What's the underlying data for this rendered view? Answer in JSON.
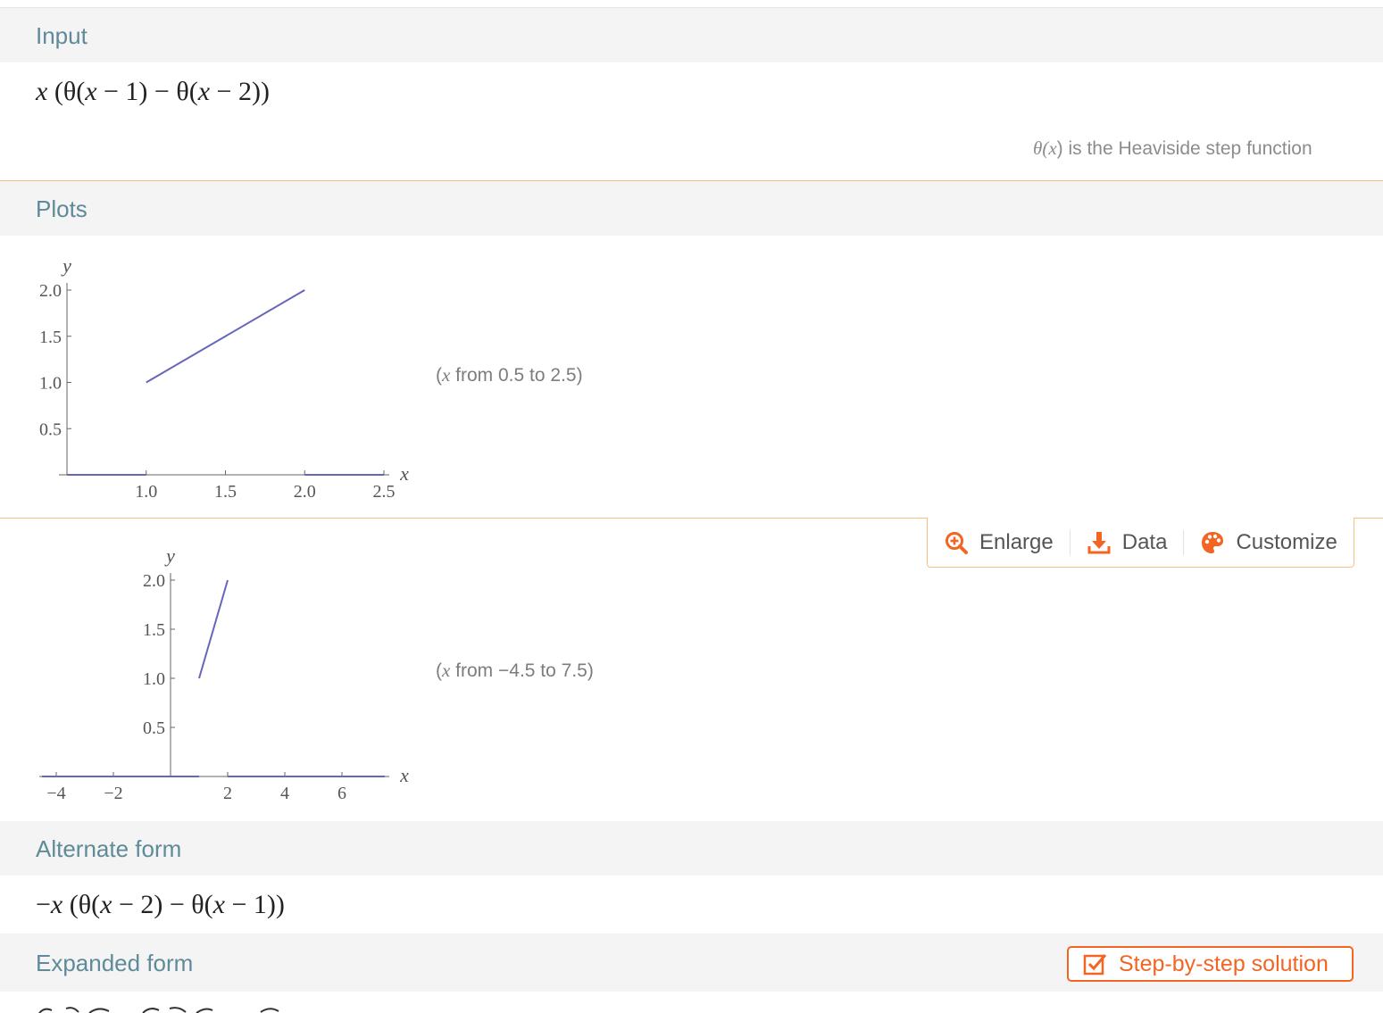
{
  "colors": {
    "header_text": "#5f8a99",
    "accent": "#f26522",
    "divider": "#f7c07f",
    "curve": "#6666bb"
  },
  "input": {
    "header": "Input",
    "expr": {
      "a": "x",
      "b": " (θ(",
      "c": "x",
      "d": " − 1) − θ(",
      "e": "x",
      "f": " − 2))"
    },
    "note": {
      "a": "θ(",
      "b": "x",
      "c": ") is the Heaviside step function"
    }
  },
  "plots": {
    "header": "Plots",
    "plot1": {
      "range_text": {
        "a": "(",
        "b": "x",
        "c": " from 0.5 to 2.5)"
      },
      "x_label": "x",
      "y_label": "y",
      "x_ticks": [
        "1.0",
        "1.5",
        "2.0",
        "2.5"
      ],
      "y_ticks": [
        "0.5",
        "1.0",
        "1.5",
        "2.0"
      ]
    },
    "plot2": {
      "range_text": {
        "a": "(",
        "b": "x",
        "c": " from −4.5 to 7.5)"
      },
      "x_label": "x",
      "y_label": "y",
      "x_ticks": [
        "−4",
        "−2",
        "2",
        "4",
        "6"
      ],
      "y_ticks": [
        "0.5",
        "1.0",
        "1.5",
        "2.0"
      ]
    },
    "toolbar": {
      "enlarge": "Enlarge",
      "data": "Data",
      "customize": "Customize"
    }
  },
  "chart_data": [
    {
      "type": "line",
      "x": [
        0.5,
        1.0,
        1.0,
        2.0,
        2.0,
        2.5
      ],
      "y": [
        0,
        0,
        1.0,
        2.0,
        0,
        0
      ],
      "segments": [
        {
          "x": [
            0.5,
            1.0
          ],
          "y": [
            0,
            0
          ]
        },
        {
          "x": [
            1.0,
            2.0
          ],
          "y": [
            1.0,
            2.0
          ]
        },
        {
          "x": [
            2.0,
            2.5
          ],
          "y": [
            0,
            0
          ]
        }
      ],
      "xlim": [
        0.5,
        2.5
      ],
      "ylim": [
        0,
        2.0
      ],
      "xlabel": "x",
      "ylabel": "y"
    },
    {
      "type": "line",
      "x": [
        -4.5,
        1.0,
        1.0,
        2.0,
        2.0,
        7.5
      ],
      "y": [
        0,
        0,
        1.0,
        2.0,
        0,
        0
      ],
      "segments": [
        {
          "x": [
            -4.5,
            1.0
          ],
          "y": [
            0,
            0
          ]
        },
        {
          "x": [
            1.0,
            2.0
          ],
          "y": [
            1.0,
            2.0
          ]
        },
        {
          "x": [
            2.0,
            7.5
          ],
          "y": [
            0,
            0
          ]
        }
      ],
      "xlim": [
        -4.5,
        7.5
      ],
      "ylim": [
        0,
        2.0
      ],
      "xlabel": "x",
      "ylabel": "y"
    }
  ],
  "alternate": {
    "header": "Alternate form",
    "expr": {
      "a": "−",
      "b": "x",
      "c": " (θ(",
      "d": "x",
      "e": " − 2) − θ(",
      "f": "x",
      "g": " − 1))"
    }
  },
  "expanded": {
    "header": "Expanded form",
    "step_button": "Step-by-step solution"
  }
}
